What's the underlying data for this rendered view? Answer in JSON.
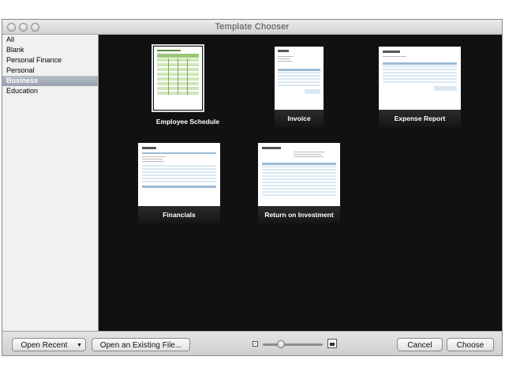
{
  "window": {
    "title": "Template Chooser"
  },
  "sidebar": {
    "items": [
      {
        "label": "All"
      },
      {
        "label": "Blank"
      },
      {
        "label": "Personal Finance"
      },
      {
        "label": "Personal"
      },
      {
        "label": "Business",
        "selected": true
      },
      {
        "label": "Education"
      }
    ]
  },
  "templates": [
    {
      "label": "Employee Schedule",
      "selected": true
    },
    {
      "label": "Invoice"
    },
    {
      "label": "Expense Report"
    },
    {
      "label": "Financials"
    },
    {
      "label": "Return on Investment"
    }
  ],
  "footer": {
    "open_recent": "Open Recent",
    "open_existing": "Open an Existing File...",
    "cancel": "Cancel",
    "choose": "Choose",
    "zoom_icons": [
      "small-picture-icon",
      "large-picture-icon"
    ]
  },
  "colors": {
    "gallery_bg": "#111111",
    "selection": "#98a1ae",
    "schedule_green": "#cfe6b8",
    "table_blue": "#dbe8f2"
  }
}
